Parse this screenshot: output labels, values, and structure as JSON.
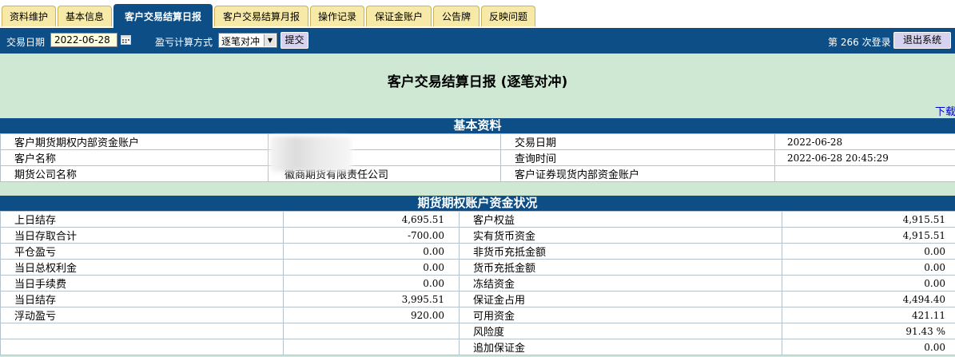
{
  "tabs": [
    {
      "label": "资料维护",
      "active": false
    },
    {
      "label": "基本信息",
      "active": false
    },
    {
      "label": "客户交易结算日报",
      "active": true
    },
    {
      "label": "客户交易结算月报",
      "active": false
    },
    {
      "label": "操作记录",
      "active": false
    },
    {
      "label": "保证金账户",
      "active": false
    },
    {
      "label": "公告牌",
      "active": false
    },
    {
      "label": "反映问题",
      "active": false
    }
  ],
  "toolbar": {
    "date_label": "交易日期",
    "date_value": "2022-06-28",
    "calc_label": "盈亏计算方式",
    "calc_value": "逐笔对冲",
    "submit_label": "提交",
    "login_prefix": "第",
    "login_count": "266",
    "login_suffix": "次登录",
    "logout_label": "退出系统"
  },
  "page_title": "客户交易结算日报  (逐笔对冲)",
  "download_label": "下载",
  "basic_info": {
    "header": "基本资料",
    "rows": [
      {
        "l1": "客户期货期权内部资金账户",
        "v1": "",
        "l2": "交易日期",
        "v2": "2022-06-28"
      },
      {
        "l1": "客户名称",
        "v1": "",
        "l2": "查询时间",
        "v2": "2022-06-28 20:45:29"
      },
      {
        "l1": "期货公司名称",
        "v1": "徽商期货有限责任公司",
        "l2": "客户证券现货内部资金账户",
        "v2": ""
      }
    ]
  },
  "fund_status": {
    "header": "期货期权账户资金状况",
    "rows": [
      {
        "l1": "上日结存",
        "v1": "4,695.51",
        "l2": "客户权益",
        "v2": "4,915.51"
      },
      {
        "l1": "当日存取合计",
        "v1": "-700.00",
        "l2": "实有货币资金",
        "v2": "4,915.51"
      },
      {
        "l1": "平仓盈亏",
        "v1": "0.00",
        "l2": "非货币充抵金额",
        "v2": "0.00"
      },
      {
        "l1": "当日总权利金",
        "v1": "0.00",
        "l2": "货币充抵金额",
        "v2": "0.00"
      },
      {
        "l1": "当日手续费",
        "v1": "0.00",
        "l2": "冻结资金",
        "v2": "0.00"
      },
      {
        "l1": "当日结存",
        "v1": "3,995.51",
        "l2": "保证金占用",
        "v2": "4,494.40"
      },
      {
        "l1": "浮动盈亏",
        "v1": "920.00",
        "l2": "可用资金",
        "v2": "421.11"
      },
      {
        "l1": "",
        "v1": "",
        "l2": "风险度",
        "v2": "91.43 %"
      },
      {
        "l1": "",
        "v1": "",
        "l2": "追加保证金",
        "v2": "0.00"
      }
    ]
  },
  "colors": {
    "accent": "#0d4e86",
    "tab": "#f7e9a8",
    "background": "#cfe8d4"
  }
}
